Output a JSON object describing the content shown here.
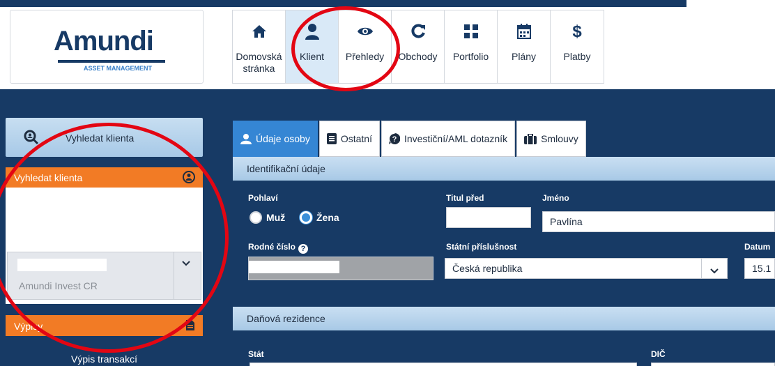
{
  "logo": {
    "name": "Amundi",
    "subtitle": "ASSET MANAGEMENT"
  },
  "nav": {
    "items": [
      {
        "label": "Domovská stránka",
        "icon": "home-icon"
      },
      {
        "label": "Klient",
        "icon": "user-icon"
      },
      {
        "label": "Přehledy",
        "icon": "eye-icon"
      },
      {
        "label": "Obchody",
        "icon": "refresh-icon"
      },
      {
        "label": "Portfolio",
        "icon": "grid-icon"
      },
      {
        "label": "Plány",
        "icon": "calendar-icon"
      },
      {
        "label": "Platby",
        "icon": "dollar-icon"
      }
    ],
    "active": "Klient"
  },
  "sidebar": {
    "search_button": "Vyhledat klienta",
    "search_panel_title": "Vyhledat klienta",
    "company_select_value": "Amundi Invest CR",
    "statements_title": "Výpisy",
    "statements_link": "Výpis transakcí"
  },
  "tabs": [
    {
      "label": "Údaje osoby",
      "icon": "user-icon"
    },
    {
      "label": "Ostatní",
      "icon": "document-icon"
    },
    {
      "label": "Investiční/AML dotazník",
      "icon": "question-icon"
    },
    {
      "label": "Smlouvy",
      "icon": "briefcase-icon"
    }
  ],
  "identification": {
    "title": "Identifikační údaje",
    "gender_label": "Pohlaví",
    "gender_options": [
      "Muž",
      "Žena"
    ],
    "gender_selected": "Žena",
    "title_before_label": "Titul před",
    "title_before_value": "",
    "first_name_label": "Jméno",
    "first_name_value": "Pavlína",
    "birth_number_label": "Rodné číslo",
    "nationality_label": "Státní příslušnost",
    "nationality_value": "Česká republika",
    "date_label": "Datum",
    "date_value": "15.1"
  },
  "tax": {
    "title": "Daňová rezidence",
    "state_label": "Stát",
    "tin_label": "DIČ"
  },
  "colors": {
    "navy": "#173a65",
    "orange": "#f27b25",
    "accent": "#3586d4",
    "annotation": "#e30613"
  }
}
